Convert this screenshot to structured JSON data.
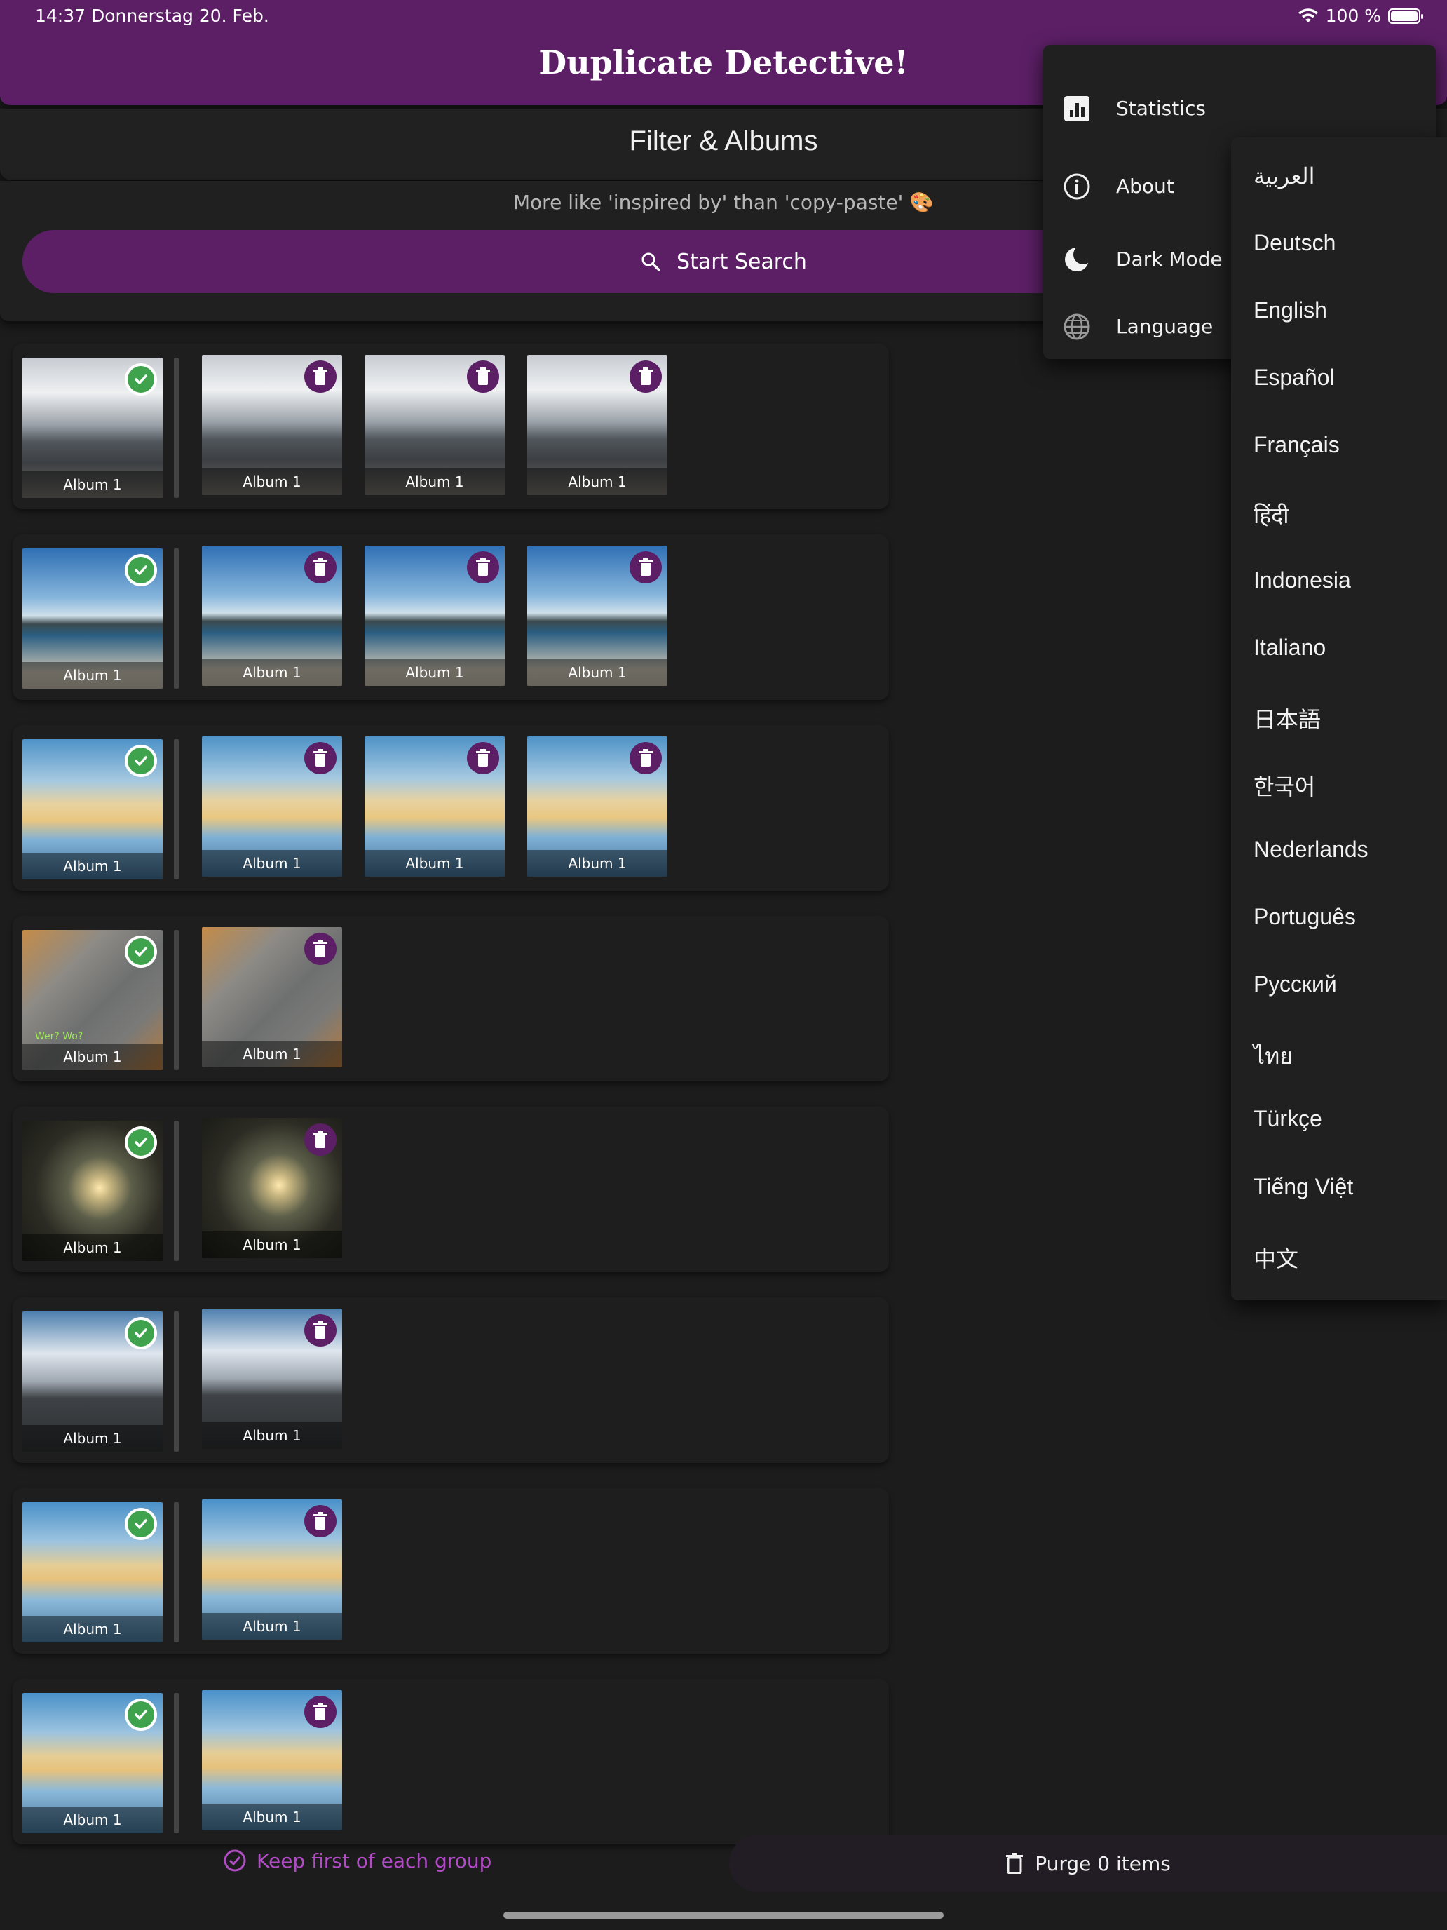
{
  "status": {
    "time_date": "14:37   Donnerstag 20. Feb.",
    "battery": "100 %"
  },
  "app": {
    "title": "Duplicate Detective!"
  },
  "filter": {
    "label": "Filter & Albums"
  },
  "tagline": "More like 'inspired by' than 'copy-paste' 🎨",
  "search": {
    "label": "Start Search"
  },
  "album_label": "Album 1",
  "groups": [
    {
      "count": 4,
      "scene": "cloud"
    },
    {
      "count": 4,
      "scene": "bay"
    },
    {
      "count": 4,
      "scene": "beach"
    },
    {
      "count": 2,
      "scene": "cat"
    },
    {
      "count": 2,
      "scene": "sunset"
    },
    {
      "count": 2,
      "scene": "cloud2"
    },
    {
      "count": 2,
      "scene": "beach2"
    },
    {
      "count": 2,
      "scene": "beach2"
    }
  ],
  "cat_caption": "Wer? Wo?",
  "bottom": {
    "keep_first": "Keep first of each group",
    "purge": "Purge 0 items"
  },
  "menu": {
    "items": [
      {
        "label": "Statistics",
        "icon": "bar-chart-icon"
      },
      {
        "label": "About",
        "icon": "info-icon"
      },
      {
        "label": "Dark Mode",
        "icon": "moon-icon"
      },
      {
        "label": "Language",
        "icon": "globe-icon"
      }
    ]
  },
  "languages": [
    "العربية",
    "Deutsch",
    "English",
    "Español",
    "Français",
    "हिंदी",
    "Indonesia",
    "Italiano",
    "日本語",
    "한국어",
    "Nederlands",
    "Português",
    "Русский",
    "ไทย",
    "Türkçe",
    "Tiếng Việt",
    "中文"
  ],
  "colors": {
    "accent": "#5c1f66",
    "keep": "#3fa34d",
    "keep_text": "#b04cc4",
    "background": "#1c1c1c"
  }
}
